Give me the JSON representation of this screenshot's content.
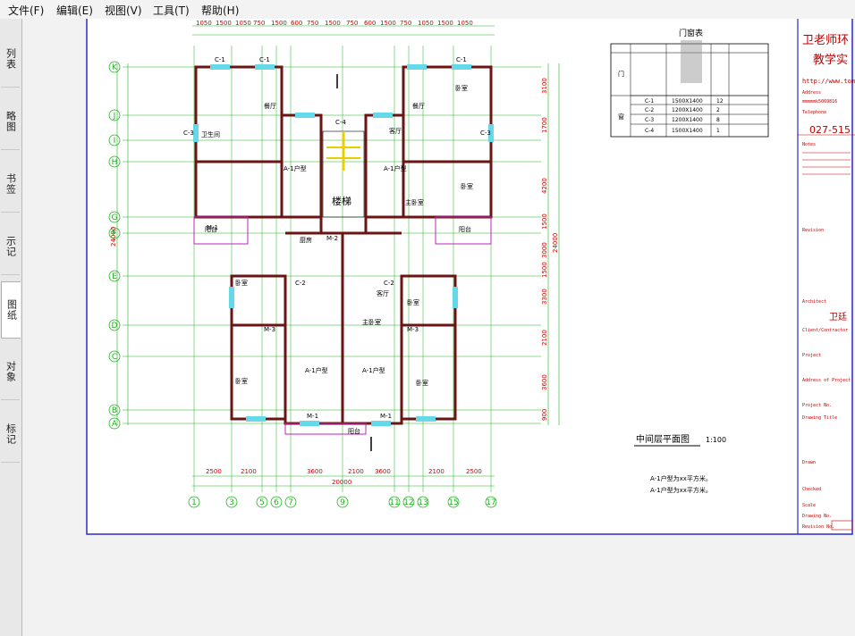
{
  "menu": {
    "file": "文件(F)",
    "edit": "编辑(E)",
    "view": "视图(V)",
    "tools": "工具(T)",
    "help": "帮助(H)"
  },
  "side_tabs": [
    "列表",
    "略图",
    "书签",
    "示记",
    "图纸",
    "对象",
    "标记"
  ],
  "active_tab": "图纸",
  "drawing": {
    "title": "中间层平面图",
    "scale": "1:100",
    "notes": [
      "A-1户型为xx平方米。",
      "A-1户型为xx平方米。"
    ],
    "stair_label": "楼梯",
    "unit_labels": [
      "A-1户型",
      "A-1户型",
      "A-1户型",
      "A-1户型"
    ],
    "room_labels": [
      "卧室",
      "卧室",
      "客厅",
      "客厅",
      "卧室",
      "卧室",
      "主卧室",
      "卧室",
      "卧室",
      "主卧室",
      "厨房",
      "卫生间",
      "餐厅",
      "餐厅",
      "阳台",
      "阳台",
      "阳台"
    ],
    "axes_left": [
      "K",
      "J",
      "I",
      "H",
      "G",
      "F",
      "E",
      "D",
      "C",
      "B",
      "A"
    ],
    "axes_bottom": [
      "1",
      "3",
      "5",
      "6",
      "7",
      "9",
      "11",
      "12",
      "13",
      "15",
      "17"
    ],
    "dims_top": [
      "1050",
      "1500",
      "1050",
      "750",
      "1500",
      "600",
      "750",
      "1500",
      "750",
      "600",
      "1500",
      "750",
      "1050",
      "1500",
      "1050"
    ],
    "dims_bottom": [
      "2500",
      "2100",
      "3600",
      "2100",
      "3600",
      "2100",
      "2500"
    ],
    "dim_total": "20000",
    "dims_left_total": "24000",
    "dims_right": [
      "3100",
      "1700",
      "4200",
      "1500",
      "3000",
      "1500",
      "3300",
      "2100",
      "3600",
      "900"
    ],
    "dims_right_total": "24000",
    "window_tags": [
      "C-1",
      "C-1",
      "C-1",
      "C-2",
      "C-2",
      "C-3",
      "C-3",
      "C-4",
      "M-1",
      "M-1",
      "M-1",
      "M-2",
      "M-3",
      "M-3"
    ],
    "door_window_table": {
      "title": "门窗表",
      "rows": [
        {
          "code": "C-1",
          "size": "1500X1400",
          "count": "12"
        },
        {
          "code": "C-2",
          "size": "1200X1400",
          "count": "2"
        },
        {
          "code": "C-3",
          "size": "1200X1400",
          "count": "8"
        },
        {
          "code": "C-4",
          "size": "1500X1400",
          "count": "1"
        }
      ],
      "group_door": "门",
      "group_window": "窗"
    }
  },
  "title_block": {
    "company_line1": "卫老师环",
    "company_line2": "教学实",
    "url": "http://www.tome",
    "phone": "027-515",
    "email_label": "Address",
    "email": "mmmmmk5069816",
    "tel_label": "Telephone",
    "fields": [
      "Notes",
      "Revision",
      "Architect",
      "Client/Contractor",
      "Project",
      "Address of Project",
      "Project No.",
      "Drawing Title",
      "Drawn",
      "Checked",
      "Scale",
      "Drawing No.",
      "Revision No."
    ],
    "architect_name": "卫廷"
  }
}
